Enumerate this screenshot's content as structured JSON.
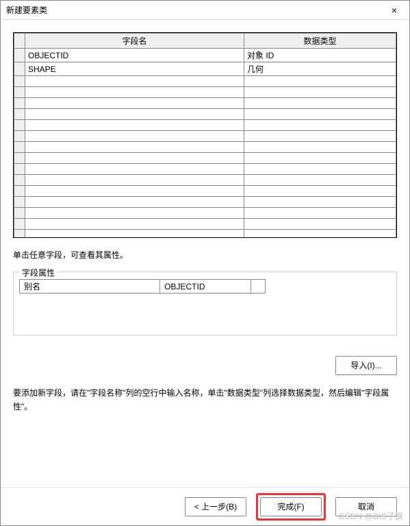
{
  "window": {
    "title": "新建要素类"
  },
  "close_label": "×",
  "grid": {
    "headers": {
      "field_name": "字段名",
      "data_type": "数据类型"
    },
    "rows": [
      {
        "name": "OBJECTID",
        "type": "对象 ID"
      },
      {
        "name": "SHAPE",
        "type": "几何"
      }
    ],
    "empty_rows": 17
  },
  "hint": "单击任意字段，可查看其属性。",
  "props": {
    "group_label": "字段属性",
    "alias_key": "别名",
    "alias_value": "OBJECTID"
  },
  "import_btn": "导入(I)...",
  "instruction": "要添加新字段，请在\"字段名称\"列的空行中输入名称，单击\"数据类型\"列选择数据类型，然后编辑\"字段属性\"。",
  "footer": {
    "back": "< 上一步(B)",
    "finish": "完成(F)",
    "cancel": "取消"
  },
  "watermark": "CSDN @GIS子枫"
}
